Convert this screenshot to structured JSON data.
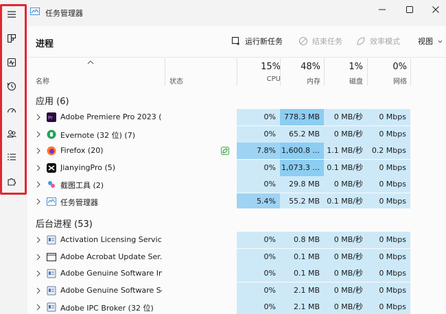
{
  "window": {
    "title": "任务管理器"
  },
  "toolbar": {
    "page_title": "进程",
    "run_new_task": "运行新任务",
    "end_task": "结束任务",
    "efficiency_mode": "效率模式",
    "view": "视图"
  },
  "header": {
    "name": "名称",
    "status": "状态",
    "cpu_pct": "15%",
    "cpu": "CPU",
    "mem_pct": "48%",
    "mem": "内存",
    "disk_pct": "1%",
    "disk": "磁盘",
    "net_pct": "0%",
    "net": "网络"
  },
  "groups": {
    "apps": "应用 (6)",
    "background": "后台进程 (53)"
  },
  "rows": [
    {
      "name": "Adobe Premiere Pro 2023 (...",
      "icon": "premiere-icon",
      "cpu": "0%",
      "mem": "778.3 MB",
      "disk": "0 MB/秒",
      "net": "0 Mbps"
    },
    {
      "name": "Evernote (32 位) (7)",
      "icon": "evernote-icon",
      "cpu": "0%",
      "mem": "65.2 MB",
      "disk": "0 MB/秒",
      "net": "0 Mbps"
    },
    {
      "name": "Firefox (20)",
      "icon": "firefox-icon",
      "cpu": "7.8%",
      "mem": "1,600.8 ...",
      "disk": "1.1 MB/秒",
      "net": "0.2 Mbps"
    },
    {
      "name": "JianyingPro (5)",
      "icon": "jianying-icon",
      "cpu": "0%",
      "mem": "1,073.3 ...",
      "disk": "0.1 MB/秒",
      "net": "0 Mbps"
    },
    {
      "name": "截图工具 (2)",
      "icon": "snipping-tool-icon",
      "cpu": "0%",
      "mem": "29.8 MB",
      "disk": "0 MB/秒",
      "net": "0 Mbps"
    },
    {
      "name": "任务管理器",
      "icon": "task-manager-icon",
      "cpu": "5.4%",
      "mem": "55.2 MB",
      "disk": "0.1 MB/秒",
      "net": "0 Mbps"
    }
  ],
  "bg_rows": [
    {
      "name": "Activation Licensing Service...",
      "icon": "service-icon",
      "cpu": "0%",
      "mem": "0.8 MB",
      "disk": "0 MB/秒",
      "net": "0 Mbps"
    },
    {
      "name": "Adobe Acrobat Update Ser...",
      "icon": "window-icon",
      "cpu": "0%",
      "mem": "0.1 MB",
      "disk": "0 MB/秒",
      "net": "0 Mbps"
    },
    {
      "name": "Adobe Genuine Software In...",
      "icon": "service-icon",
      "cpu": "0%",
      "mem": "0.1 MB",
      "disk": "0 MB/秒",
      "net": "0 Mbps"
    },
    {
      "name": "Adobe Genuine Software Se...",
      "icon": "service-icon",
      "cpu": "0%",
      "mem": "2.1 MB",
      "disk": "0 MB/秒",
      "net": "0 Mbps"
    },
    {
      "name": "Adobe IPC Broker (32 位)",
      "icon": "service-icon",
      "cpu": "0%",
      "mem": "2.1 MB",
      "disk": "0 MB/秒",
      "net": "0 Mbps"
    }
  ],
  "colors": {
    "heat_light": "#cde9f8",
    "heat_mid": "#9fd3f3",
    "heat_strong": "#8ccdf2",
    "highlight": "#e0282e"
  }
}
